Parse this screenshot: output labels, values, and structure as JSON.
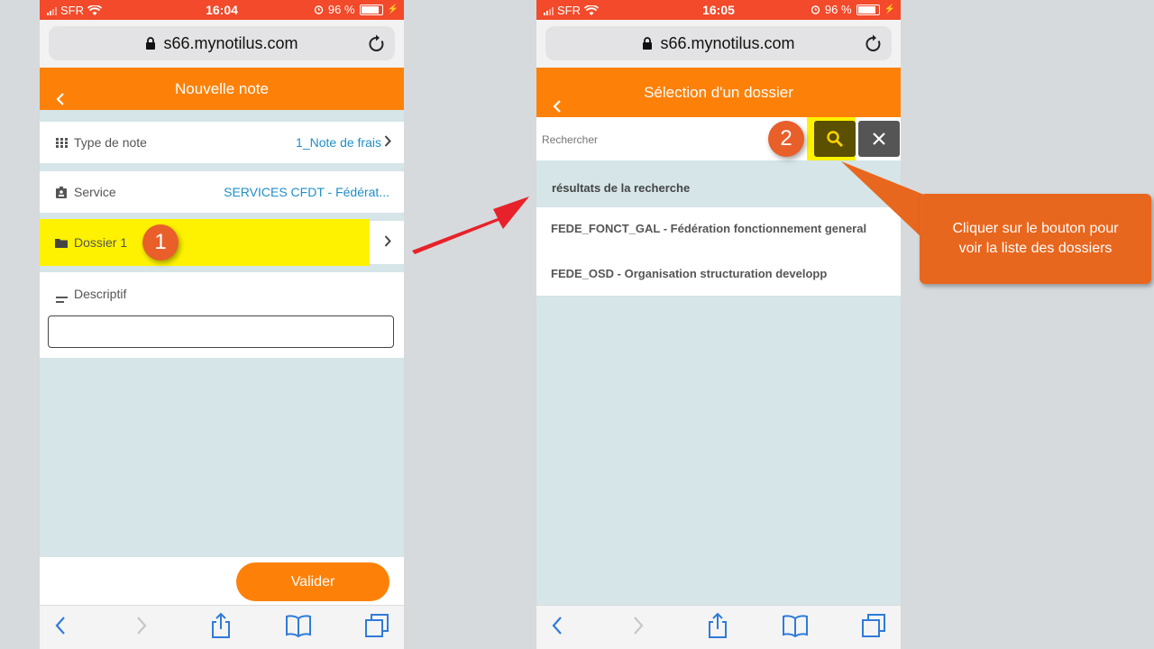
{
  "left_phone": {
    "status": {
      "carrier": "SFR",
      "time": "16:04",
      "battery": "96 %"
    },
    "url": "s66.mynotilus.com",
    "header": {
      "title": "Nouvelle note"
    },
    "rows": {
      "type_de_note": {
        "label": "Type de note",
        "value": "1_Note de frais"
      },
      "service": {
        "label": "Service",
        "value": "SERVICES CFDT - Fédérat..."
      },
      "dossier": {
        "label": "Dossier 1"
      },
      "descriptif": {
        "label": "Descriptif",
        "value": ""
      }
    },
    "validate_button": "Valider",
    "step_badge": "1"
  },
  "right_phone": {
    "status": {
      "carrier": "SFR",
      "time": "16:05",
      "battery": "96 %"
    },
    "url": "s66.mynotilus.com",
    "header": {
      "title": "Sélection d'un dossier"
    },
    "search": {
      "placeholder": "Rechercher",
      "value": ""
    },
    "results_header": "résultats de la recherche",
    "results": [
      "FEDE_FONCT_GAL - Fédération fonctionnement general",
      "FEDE_OSD - Organisation structuration developp"
    ],
    "step_badge": "2"
  },
  "callout_text": "Cliquer sur le bouton pour voir la liste des dossiers",
  "colors": {
    "status_bar": "#f24a2a",
    "app_header": "#fd8109",
    "highlight": "#fff200",
    "link_blue": "#1f8fc7",
    "badge": "#e85f2a",
    "callout": "#e8671e",
    "arrow": "#e8222a"
  }
}
